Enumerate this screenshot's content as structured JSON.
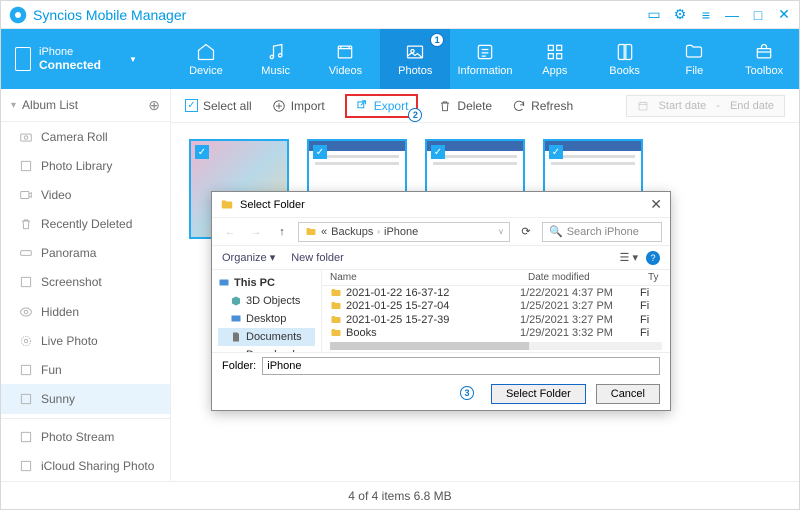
{
  "app": {
    "title": "Syncios Mobile Manager"
  },
  "device": {
    "name": "iPhone",
    "status": "Connected"
  },
  "nav": {
    "device": "Device",
    "music": "Music",
    "videos": "Videos",
    "photos": "Photos",
    "information": "Information",
    "apps": "Apps",
    "books": "Books",
    "file": "File",
    "toolbox": "Toolbox"
  },
  "sidebar": {
    "head": "Album List",
    "items": [
      "Camera Roll",
      "Photo Library",
      "Video",
      "Recently Deleted",
      "Panorama",
      "Screenshot",
      "Hidden",
      "Live Photo",
      "Fun",
      "Sunny"
    ],
    "extras": [
      "Photo Stream",
      "iCloud Sharing Photo"
    ]
  },
  "toolbar": {
    "selectall": "Select all",
    "import": "Import",
    "export": "Export",
    "delete": "Delete",
    "refresh": "Refresh",
    "start_date": "Start date",
    "end_date": "End date",
    "dash": "-"
  },
  "dialog": {
    "title": "Select Folder",
    "crumb": [
      "Backups",
      "iPhone"
    ],
    "search_ph": "Search iPhone",
    "organize": "Organize",
    "newfolder": "New folder",
    "tree": [
      "This PC",
      "3D Objects",
      "Desktop",
      "Documents",
      "Downloads"
    ],
    "cols": {
      "name": "Name",
      "date": "Date modified",
      "type": "Ty"
    },
    "rows": [
      {
        "name": "2021-01-22 16-37-12",
        "date": "1/22/2021 4:37 PM",
        "type": "Fi"
      },
      {
        "name": "2021-01-25 15-27-04",
        "date": "1/25/2021 3:27 PM",
        "type": "Fi"
      },
      {
        "name": "2021-01-25 15-27-39",
        "date": "1/25/2021 3:27 PM",
        "type": "Fi"
      },
      {
        "name": "Books",
        "date": "1/29/2021 3:32 PM",
        "type": "Fi"
      }
    ],
    "folder_label": "Folder:",
    "folder_value": "iPhone",
    "select": "Select Folder",
    "cancel": "Cancel"
  },
  "status": "4 of 4 items 6.8 MB",
  "callouts": {
    "1": "1",
    "2": "2",
    "3": "3"
  }
}
